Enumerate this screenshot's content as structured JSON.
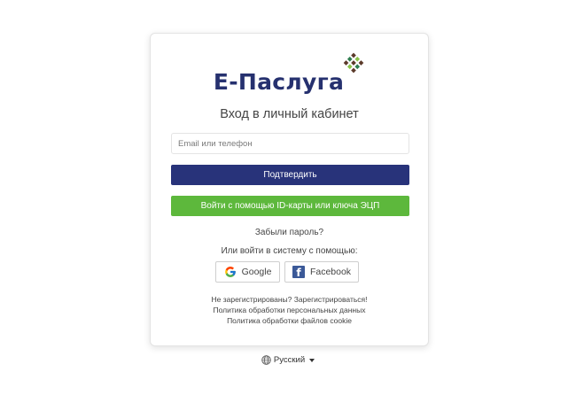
{
  "logo": {
    "text": "E-Паслуга"
  },
  "login": {
    "heading": "Вход в личный кабинет",
    "input_placeholder": "Email или телефон",
    "input_value": "",
    "submit_label": "Подтвердить",
    "id_card_label": "Войти с помощью ID-карты или ключа ЭЦП",
    "forgot_label": "Забыли пароль?",
    "social_label": "Или войти в систему с помощью:",
    "google_label": "Google",
    "facebook_label": "Facebook"
  },
  "footer": {
    "register_label": "Не зарегистрированы? Зарегистрироваться!",
    "privacy_label": "Политика обработки персональных данных",
    "cookie_label": "Политика обработки файлов cookie"
  },
  "language": {
    "selected": "Русский"
  },
  "colors": {
    "brand_navy": "#28337a",
    "brand_green": "#5db83c",
    "logo_dark": "#5b3a2a",
    "logo_green": "#2e7d4f"
  },
  "icons": [
    "logo-mosaic-icon",
    "google-icon",
    "facebook-icon",
    "globe-icon",
    "caret-down-icon"
  ]
}
